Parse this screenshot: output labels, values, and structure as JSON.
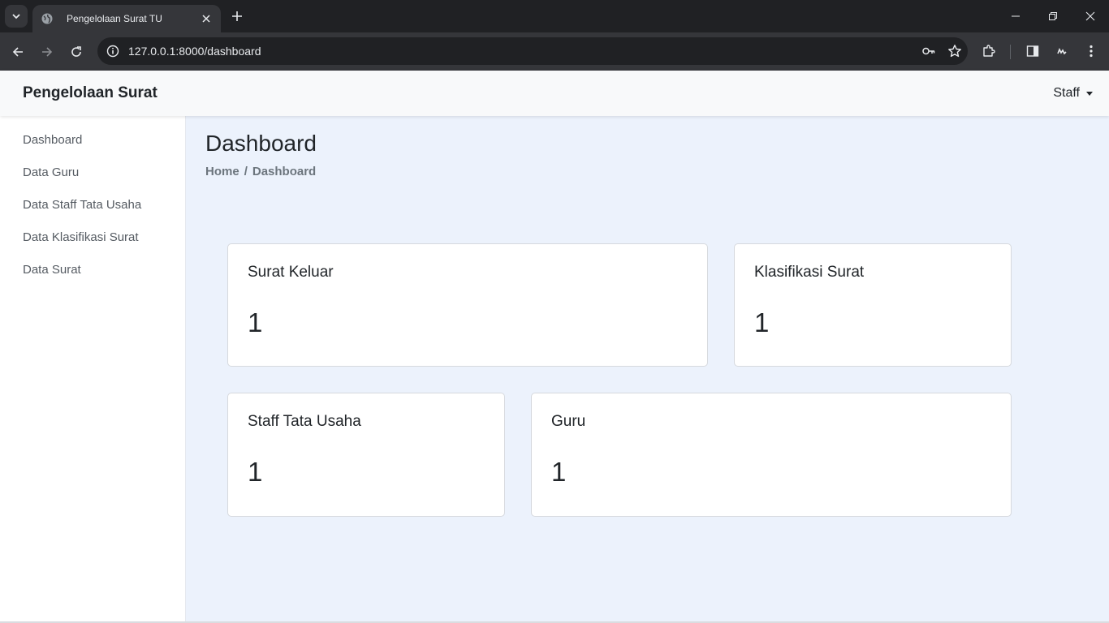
{
  "browser": {
    "tab_title": "Pengelolaan Surat TU",
    "url": "127.0.0.1:8000/dashboard"
  },
  "navbar": {
    "brand": "Pengelolaan Surat",
    "user_label": "Staff"
  },
  "sidebar": {
    "items": [
      {
        "label": "Dashboard"
      },
      {
        "label": "Data Guru"
      },
      {
        "label": "Data Staff Tata Usaha"
      },
      {
        "label": "Data Klasifikasi Surat"
      },
      {
        "label": "Data Surat"
      }
    ]
  },
  "main": {
    "title": "Dashboard",
    "breadcrumb": {
      "home": "Home",
      "separator": "/",
      "current": "Dashboard"
    },
    "cards": [
      {
        "title": "Surat Keluar",
        "value": "1"
      },
      {
        "title": "Klasifikasi Surat",
        "value": "1"
      },
      {
        "title": "Staff Tata Usaha",
        "value": "1"
      },
      {
        "title": "Guru",
        "value": "1"
      }
    ]
  },
  "colors": {
    "main_bg": "#ecf2fc",
    "navbar_bg": "#f8f9fa",
    "chrome_dark": "#202124",
    "chrome_toolbar": "#35363a"
  },
  "icons": [
    "tab-list-icon",
    "globe-icon",
    "close-icon",
    "plus-icon",
    "minimize-icon",
    "restore-icon",
    "window-close-icon",
    "back-icon",
    "forward-icon",
    "reload-icon",
    "site-info-icon",
    "key-icon",
    "star-icon",
    "extensions-icon",
    "side-panel-icon",
    "profile-icon",
    "more-icon"
  ]
}
